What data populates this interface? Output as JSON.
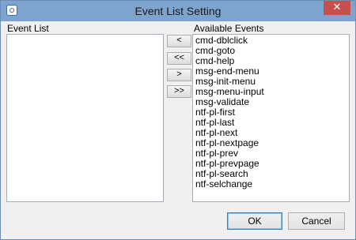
{
  "window": {
    "title": "Event List Setting",
    "close_label": "✕"
  },
  "event_list": {
    "label": "Event List",
    "items": []
  },
  "available_events": {
    "label": "Available Events",
    "items": [
      "cmd-dblclick",
      "cmd-goto",
      "cmd-help",
      "msg-end-menu",
      "msg-init-menu",
      "msg-menu-input",
      "msg-validate",
      "ntf-pl-first",
      "ntf-pl-last",
      "ntf-pl-next",
      "ntf-pl-nextpage",
      "ntf-pl-prev",
      "ntf-pl-prevpage",
      "ntf-pl-search",
      "ntf-selchange"
    ]
  },
  "transfer_buttons": {
    "move_one_left": "<",
    "move_all_left": "<<",
    "move_one_right": ">",
    "move_all_right": ">>"
  },
  "footer": {
    "ok_label": "OK",
    "cancel_label": "Cancel"
  },
  "colors": {
    "titlebar": "#7da4cf",
    "close_button": "#c7504d",
    "dialog_background": "#f0f0f0"
  },
  "icons": {
    "app": "app-icon",
    "close": "close-icon"
  }
}
